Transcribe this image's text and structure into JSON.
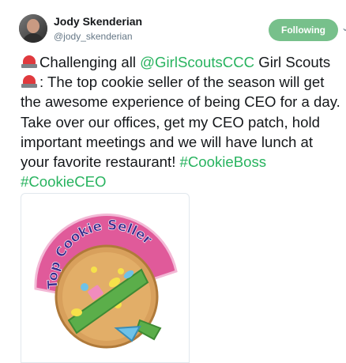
{
  "author": {
    "display_name": "Jody Skenderian",
    "handle": "@jody_skenderian"
  },
  "follow_button": {
    "label": "Following"
  },
  "tweet": {
    "part1": "Challenging all ",
    "mention": "@GirlScoutsCCC",
    "part2": " Girl Scouts ",
    "part3": ": The top cookie seller of the season will get the awesome experience of being CEO for a day. Take over our offices, get my CEO patch, hold important meetings and we will have lunch at your favorite restaurant! ",
    "hashtag1": "#CookieBoss",
    "space": " ",
    "hashtag2": "#CookieCEO"
  },
  "media": {
    "patch_text": "Top Cookie Seller"
  },
  "colors": {
    "accent_link": "#28b35f",
    "follow_button_bg": "#77c08b",
    "siren_red": "#e03a3e"
  },
  "icons": {
    "siren": "police-light-emoji",
    "caret": "chevron-down-icon"
  }
}
